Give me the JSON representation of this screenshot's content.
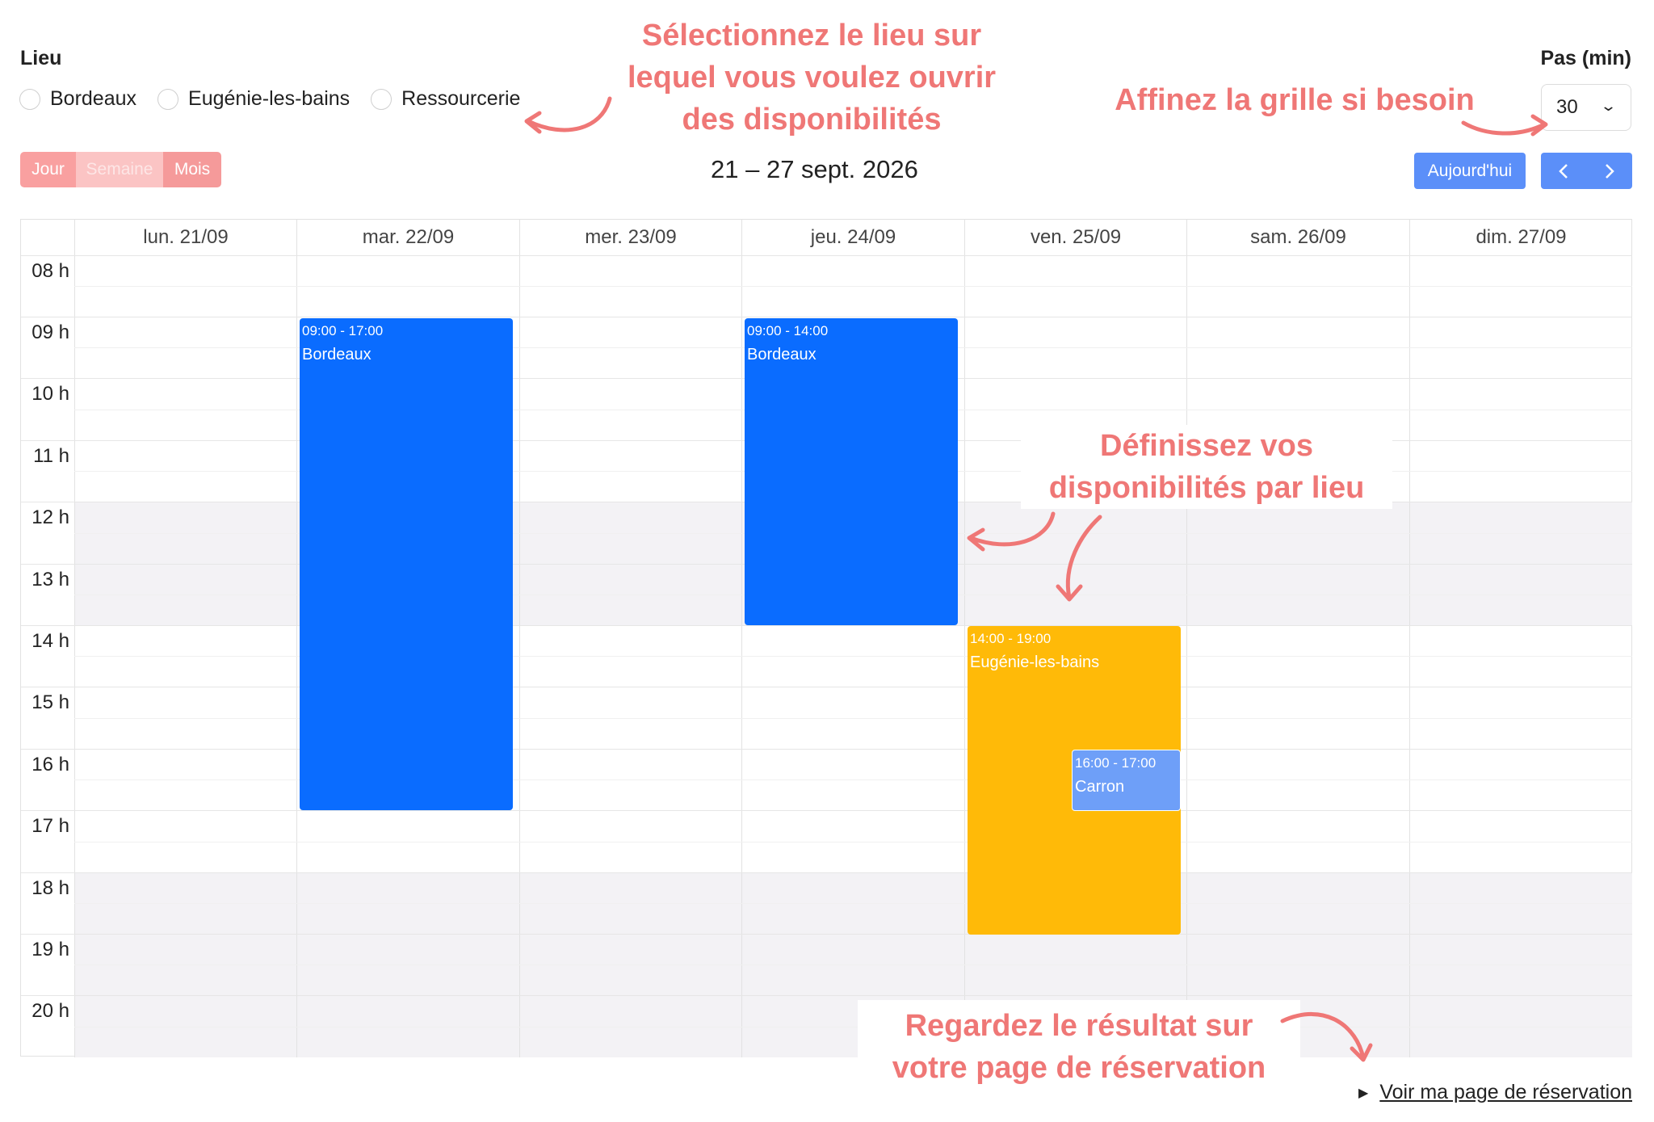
{
  "location": {
    "label": "Lieu",
    "options": [
      "Bordeaux",
      "Eugénie-les-bains",
      "Ressourcerie"
    ]
  },
  "step": {
    "label": "Pas (min)",
    "value": "30"
  },
  "view_buttons": {
    "day": "Jour",
    "week": "Semaine",
    "month": "Mois"
  },
  "range_title": "21 – 27 sept. 2026",
  "today_button": "Aujourd'hui",
  "prev_icon": "‹",
  "next_icon": "›",
  "days": [
    "lun. 21/09",
    "mar. 22/09",
    "mer. 23/09",
    "jeu. 24/09",
    "ven. 25/09",
    "sam. 26/09",
    "dim. 27/09"
  ],
  "hours": [
    "08 h",
    "09 h",
    "10 h",
    "11 h",
    "12 h",
    "13 h",
    "14 h",
    "15 h",
    "16 h",
    "17 h",
    "18 h",
    "19 h",
    "20 h"
  ],
  "events": [
    {
      "time": "09:00 - 17:00",
      "title": "Bordeaux",
      "color": "#0a6cff"
    },
    {
      "time": "09:00 - 14:00",
      "title": "Bordeaux",
      "color": "#0a6cff"
    },
    {
      "time": "14:00 - 19:00",
      "title": "Eugénie-les-bains",
      "color": "#ffba08"
    },
    {
      "time": "16:00 - 17:00",
      "title": "Carron",
      "color": "#6e9ff8"
    }
  ],
  "annotations": {
    "select_location": "Sélectionnez le lieu sur lequel vous voulez ouvrir des disponibilités",
    "refine_grid": "Affinez la grille si besoin",
    "define_availability": "Définissez vos disponibilités par lieu",
    "see_result": "Regardez le résultat sur votre page de réservation"
  },
  "booking_link": "Voir ma page de réservation",
  "colors": {
    "accent_blue": "#5b8ff9",
    "event_blue": "#0a6cff",
    "event_yellow": "#ffba08",
    "annotation": "#ef7776",
    "view_pink": "#f9a0a0"
  }
}
